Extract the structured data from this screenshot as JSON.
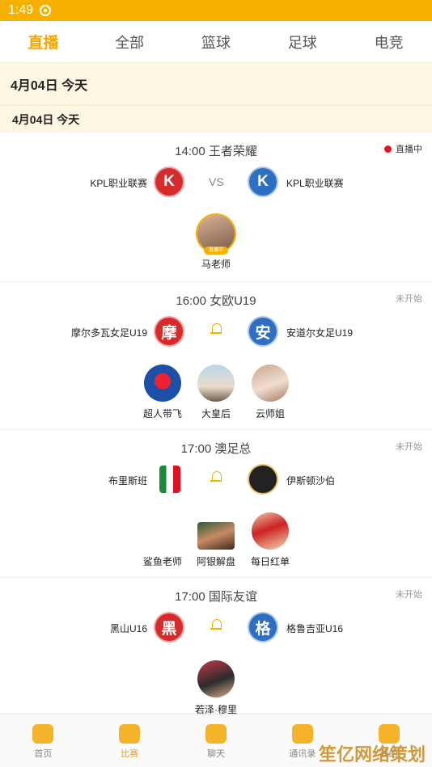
{
  "status_bar": {
    "time": "1:49"
  },
  "tabs": [
    {
      "label": "直播",
      "active": true
    },
    {
      "label": "全部",
      "active": false
    },
    {
      "label": "篮球",
      "active": false
    },
    {
      "label": "足球",
      "active": false
    },
    {
      "label": "电竞",
      "active": false
    }
  ],
  "date_header": "4月04日  今天",
  "date_sub": "4月04日  今天",
  "matches": [
    {
      "time_league": "14:00  王者荣耀",
      "status": "直播中",
      "home": "KPL职业联赛",
      "home_logo": "K",
      "away": "KPL职业联赛",
      "away_logo": "K",
      "vs": "VS",
      "anchors": [
        {
          "name": "马老师",
          "tag": "直播中"
        }
      ]
    },
    {
      "time_league": "16:00  女欧U19",
      "status": "未开始",
      "home": "摩尔多瓦女足U19",
      "home_logo": "摩",
      "away": "安道尔女足U19",
      "away_logo": "安",
      "anchors": [
        {
          "name": "超人带飞"
        },
        {
          "name": "大皇后"
        },
        {
          "name": "云师姐"
        }
      ]
    },
    {
      "time_league": "17:00  澳足总",
      "status": "未开始",
      "home": "布里斯班",
      "away": "伊斯顿沙伯",
      "anchors": [
        {
          "name": "鲨鱼老师"
        },
        {
          "name": "阿银解盘"
        },
        {
          "name": "每日红单"
        }
      ]
    },
    {
      "time_league": "17:00  国际友谊",
      "status": "未开始",
      "home": "黑山U16",
      "home_logo": "黑",
      "away": "格鲁吉亚U16",
      "away_logo": "格",
      "anchors": [
        {
          "name": "若泽·穆里"
        }
      ]
    }
  ],
  "bottom_nav": [
    {
      "label": "首页",
      "active": false
    },
    {
      "label": "比赛",
      "active": true
    },
    {
      "label": "聊天",
      "active": false
    },
    {
      "label": "通讯录",
      "active": false
    },
    {
      "label": "我的",
      "active": false
    }
  ],
  "watermark": "笙亿网络策划"
}
